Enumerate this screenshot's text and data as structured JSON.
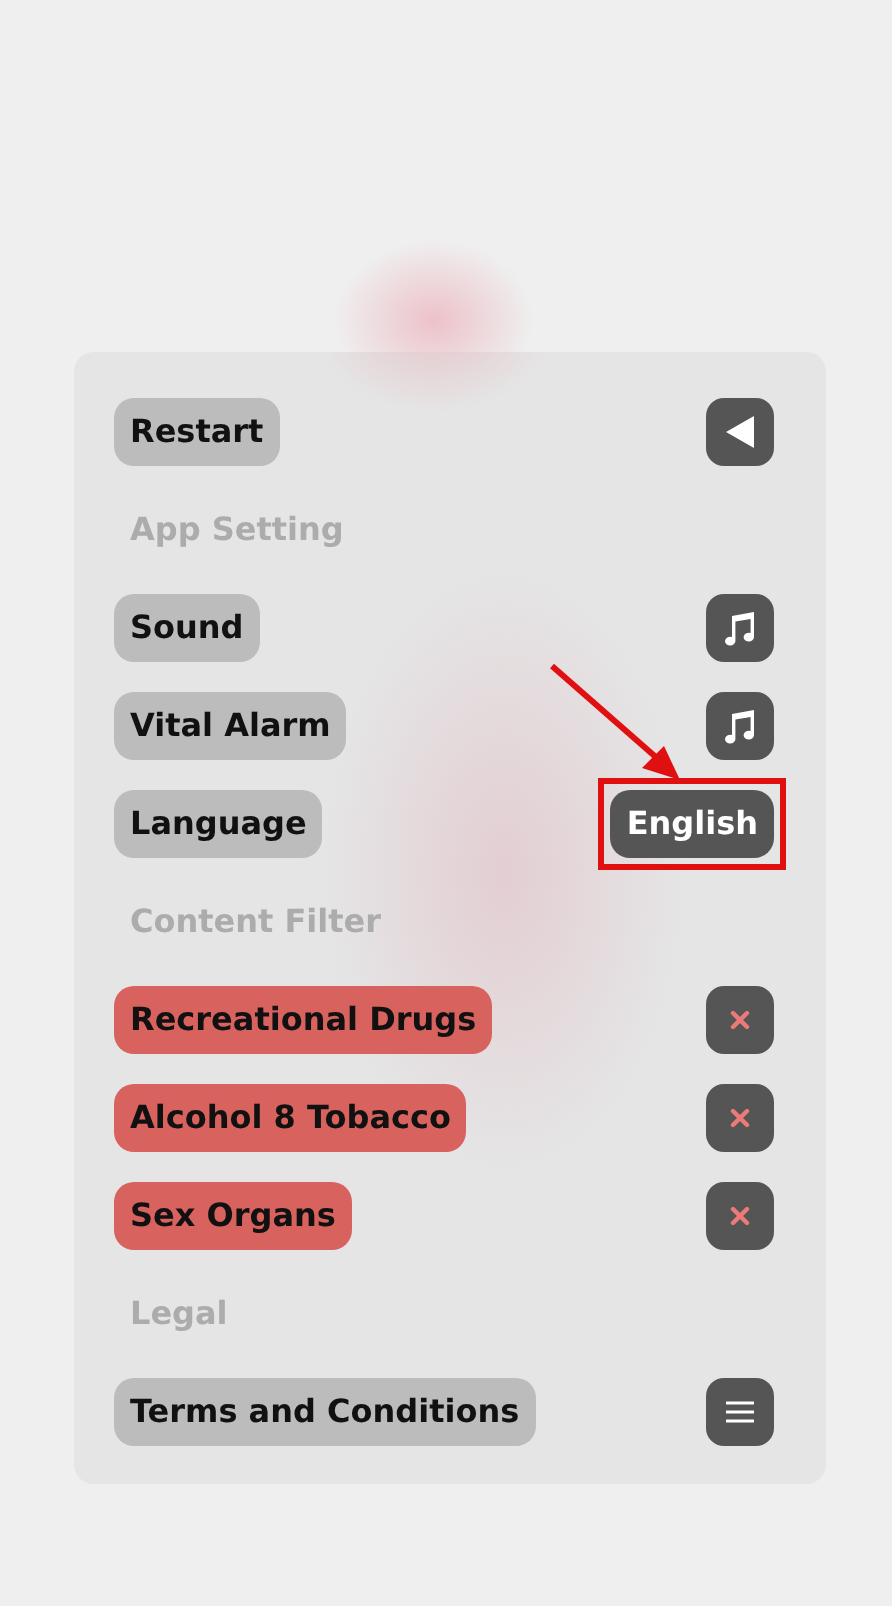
{
  "sections": [
    {
      "rows": [
        {
          "label": "Restart",
          "kind": "back"
        }
      ]
    },
    {
      "header": "App Setting",
      "rows": [
        {
          "label": "Sound",
          "kind": "music"
        },
        {
          "label": "Vital Alarm",
          "kind": "music"
        },
        {
          "label": "Language",
          "kind": "choice",
          "value": "English",
          "highlighted": true
        }
      ]
    },
    {
      "header": "Content Filter",
      "rows": [
        {
          "label": "Recreational Drugs",
          "kind": "filter",
          "blocked": true
        },
        {
          "label": "Alcohol 8 Tobacco",
          "kind": "filter",
          "blocked": true
        },
        {
          "label": "Sex Organs",
          "kind": "filter",
          "blocked": true
        }
      ]
    },
    {
      "header": "Legal",
      "rows": [
        {
          "label": "Terms and Conditions",
          "kind": "document"
        }
      ]
    }
  ]
}
